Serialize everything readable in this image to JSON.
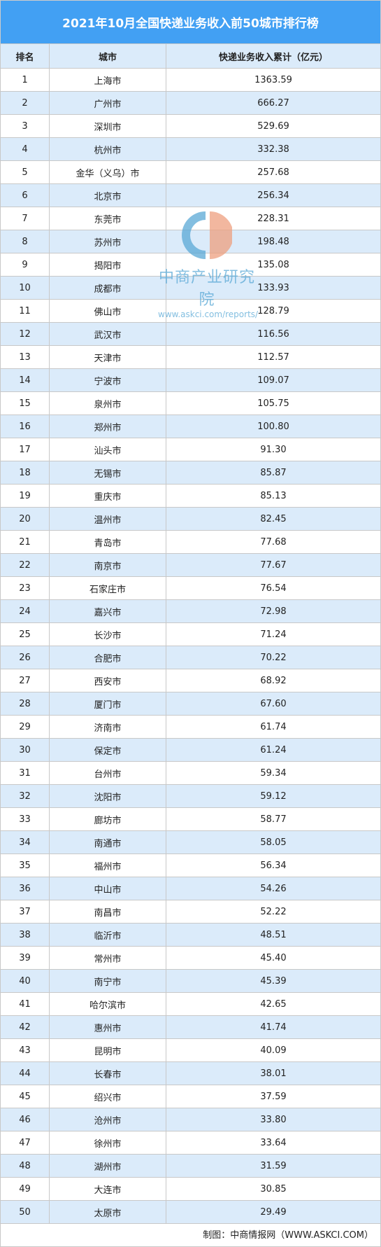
{
  "title": "2021年10月全国快递业务收入前50城市排行榜",
  "headers": [
    "排名",
    "城市",
    "快递业务收入累计（亿元）"
  ],
  "rows": [
    [
      "1",
      "上海市",
      "1363.59"
    ],
    [
      "2",
      "广州市",
      "666.27"
    ],
    [
      "3",
      "深圳市",
      "529.69"
    ],
    [
      "4",
      "杭州市",
      "332.38"
    ],
    [
      "5",
      "金华（义乌）市",
      "257.68"
    ],
    [
      "6",
      "北京市",
      "256.34"
    ],
    [
      "7",
      "东莞市",
      "228.31"
    ],
    [
      "8",
      "苏州市",
      "198.48"
    ],
    [
      "9",
      "揭阳市",
      "135.08"
    ],
    [
      "10",
      "成都市",
      "133.93"
    ],
    [
      "11",
      "佛山市",
      "128.79"
    ],
    [
      "12",
      "武汉市",
      "116.56"
    ],
    [
      "13",
      "天津市",
      "112.57"
    ],
    [
      "14",
      "宁波市",
      "109.07"
    ],
    [
      "15",
      "泉州市",
      "105.75"
    ],
    [
      "16",
      "郑州市",
      "100.80"
    ],
    [
      "17",
      "汕头市",
      "91.30"
    ],
    [
      "18",
      "无锡市",
      "85.87"
    ],
    [
      "19",
      "重庆市",
      "85.13"
    ],
    [
      "20",
      "温州市",
      "82.45"
    ],
    [
      "21",
      "青岛市",
      "77.68"
    ],
    [
      "22",
      "南京市",
      "77.67"
    ],
    [
      "23",
      "石家庄市",
      "76.54"
    ],
    [
      "24",
      "嘉兴市",
      "72.98"
    ],
    [
      "25",
      "长沙市",
      "71.24"
    ],
    [
      "26",
      "合肥市",
      "70.22"
    ],
    [
      "27",
      "西安市",
      "68.92"
    ],
    [
      "28",
      "厦门市",
      "67.60"
    ],
    [
      "29",
      "济南市",
      "61.74"
    ],
    [
      "30",
      "保定市",
      "61.24"
    ],
    [
      "31",
      "台州市",
      "59.34"
    ],
    [
      "32",
      "沈阳市",
      "59.12"
    ],
    [
      "33",
      "廊坊市",
      "58.77"
    ],
    [
      "34",
      "南通市",
      "58.05"
    ],
    [
      "35",
      "福州市",
      "56.34"
    ],
    [
      "36",
      "中山市",
      "54.26"
    ],
    [
      "37",
      "南昌市",
      "52.22"
    ],
    [
      "38",
      "临沂市",
      "48.51"
    ],
    [
      "39",
      "常州市",
      "45.40"
    ],
    [
      "40",
      "南宁市",
      "45.39"
    ],
    [
      "41",
      "哈尔滨市",
      "42.65"
    ],
    [
      "42",
      "惠州市",
      "41.74"
    ],
    [
      "43",
      "昆明市",
      "40.09"
    ],
    [
      "44",
      "长春市",
      "38.01"
    ],
    [
      "45",
      "绍兴市",
      "37.59"
    ],
    [
      "46",
      "沧州市",
      "33.80"
    ],
    [
      "47",
      "徐州市",
      "33.64"
    ],
    [
      "48",
      "湖州市",
      "31.59"
    ],
    [
      "49",
      "大连市",
      "30.85"
    ],
    [
      "50",
      "太原市",
      "29.49"
    ]
  ],
  "footer": "制图：中商情报网（WWW.ASKCI.COM）",
  "watermark": {
    "name": "中商产业研究院",
    "url": "www.askci.com/reports/"
  },
  "colors": {
    "title_bg": "#42a0f3",
    "alt_row": "#dbebfa"
  }
}
